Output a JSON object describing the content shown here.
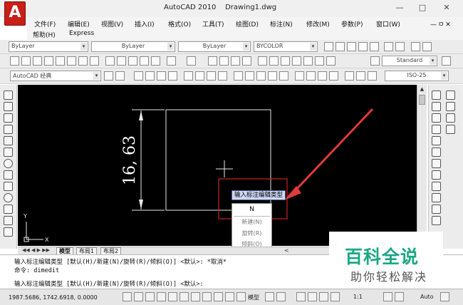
{
  "window": {
    "app": "AutoCAD 2010",
    "doc": "Drawing1.dwg",
    "logo_letter": "A",
    "controls": [
      "—",
      "□",
      "✕"
    ],
    "mdi_controls": [
      "—",
      "ㅁ",
      "✕"
    ]
  },
  "menu": [
    "文件(F)",
    "编辑(E)",
    "视图(V)",
    "插入(I)",
    "格式(O)",
    "工具(T)",
    "绘图(D)",
    "标注(N)",
    "修改(M)",
    "参数(P)",
    "窗口(W)",
    "帮助(H)",
    "Express"
  ],
  "layers_toolbar": {
    "layer": "ByLayer",
    "linetype": "ByLayer",
    "lineweight": "ByLayer",
    "color": "BYCOLOR"
  },
  "standard_toolbar": {
    "text_style": "Standard",
    "dim_style": "ISO-25"
  },
  "workspace": {
    "name": "AutoCAD 经典"
  },
  "drawing": {
    "dimension_text": "16, 63",
    "tooltip": "输入标注编辑类型",
    "options": [
      "N",
      "新建(N)",
      "旋转(R)",
      "倾斜(O)"
    ],
    "ucs_labels": [
      "Y",
      "X"
    ],
    "colors": {
      "background": "#000000",
      "highlight": "#cc2222",
      "arrow": "#e23a3a"
    }
  },
  "layout_tabs": [
    "模型",
    "布局1",
    "布局2"
  ],
  "command_line": [
    "输入标注编辑类型 [默认(H)/新建(N)/旋转(R)/倾斜(O)] <默认>: *取消*",
    "命令: dimedit",
    "输入标注编辑类型 [默认(H)/新建(N)/旋转(R)/倾斜(O)] <默认>:"
  ],
  "status_bar": {
    "coordinates": "1987.5686,  1742.6918,  0.0000",
    "model": "模型",
    "scale": "1:1",
    "auto": "Auto"
  },
  "watermark": {
    "title": "百科全说",
    "subtitle": "助你轻松解决"
  }
}
